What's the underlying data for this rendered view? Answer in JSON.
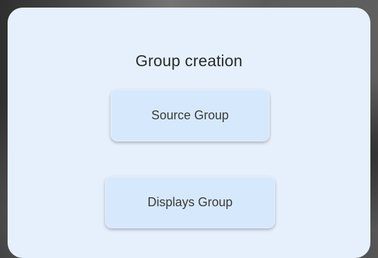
{
  "dialog": {
    "title": "Group creation",
    "buttons": {
      "source_label": "Source Group",
      "displays_label": "Displays Group"
    }
  },
  "colors": {
    "dialog_background": "#e6f0fd",
    "button_background": "#d6e8fb",
    "text": "#2a2a2a"
  }
}
